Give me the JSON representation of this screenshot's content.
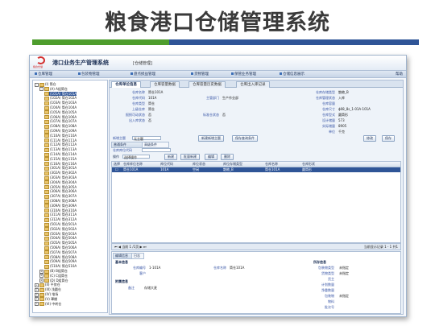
{
  "slide": {
    "title": "粮食港口仓储管理系统"
  },
  "app": {
    "logo_text": "粮食仓储",
    "title": "港口业务生产管理系统",
    "subtitle": "[仓储管理]",
    "menu": [
      "仓库管理",
      "包装物管理",
      "盘点损益管理",
      "货物管理",
      "保管业务管理",
      "仓储信息展示"
    ],
    "help": "帮助"
  },
  "tree": {
    "nodes": [
      {
        "label": "(I) 筒仓",
        "level": 0,
        "pm": "-"
      },
      {
        "label": "(A) A组筒仓",
        "level": 1,
        "pm": "-"
      },
      {
        "label": "(101A) 筒仓101A",
        "level": 2,
        "pm": "",
        "selected": true
      },
      {
        "label": "(102A) 筒仓102A",
        "level": 2,
        "pm": ""
      },
      {
        "label": "(103A) 筒仓103A",
        "level": 2,
        "pm": ""
      },
      {
        "label": "(104A) 筒仓104A",
        "level": 2,
        "pm": ""
      },
      {
        "label": "(105A) 筒仓105A",
        "level": 2,
        "pm": ""
      },
      {
        "label": "(106A) 筒仓106A",
        "level": 2,
        "pm": ""
      },
      {
        "label": "(107A) 筒仓107A",
        "level": 2,
        "pm": ""
      },
      {
        "label": "(108A) 筒仓108A",
        "level": 2,
        "pm": ""
      },
      {
        "label": "(109A) 筒仓109A",
        "level": 2,
        "pm": ""
      },
      {
        "label": "(110A) 筒仓110A",
        "level": 2,
        "pm": ""
      },
      {
        "label": "(111A) 筒仓111A",
        "level": 2,
        "pm": ""
      },
      {
        "label": "(112A) 筒仓112A",
        "level": 2,
        "pm": ""
      },
      {
        "label": "(113A) 筒仓113A",
        "level": 2,
        "pm": ""
      },
      {
        "label": "(114A) 筒仓114A",
        "level": 2,
        "pm": ""
      },
      {
        "label": "(115A) 筒仓115A",
        "level": 2,
        "pm": ""
      },
      {
        "label": "(116A) 筒仓116A",
        "level": 2,
        "pm": ""
      },
      {
        "label": "(301A) 筒仓301A",
        "level": 2,
        "pm": ""
      },
      {
        "label": "(302A) 筒仓302A",
        "level": 2,
        "pm": ""
      },
      {
        "label": "(303A) 筒仓303A",
        "level": 2,
        "pm": ""
      },
      {
        "label": "(304A) 筒仓304A",
        "level": 2,
        "pm": ""
      },
      {
        "label": "(305A) 筒仓305A",
        "level": 2,
        "pm": ""
      },
      {
        "label": "(306A) 筒仓306A",
        "level": 2,
        "pm": ""
      },
      {
        "label": "(307A) 筒仓307A",
        "level": 2,
        "pm": ""
      },
      {
        "label": "(308A) 筒仓308A",
        "level": 2,
        "pm": ""
      },
      {
        "label": "(309A) 筒仓309A",
        "level": 2,
        "pm": ""
      },
      {
        "label": "(310A) 筒仓310A",
        "level": 2,
        "pm": ""
      },
      {
        "label": "(311A) 筒仓311A",
        "level": 2,
        "pm": ""
      },
      {
        "label": "(312A) 筒仓312A",
        "level": 2,
        "pm": ""
      },
      {
        "label": "(501A) 筒仓501A",
        "level": 2,
        "pm": ""
      },
      {
        "label": "(502A) 筒仓502A",
        "level": 2,
        "pm": ""
      },
      {
        "label": "(503A) 筒仓503A",
        "level": 2,
        "pm": ""
      },
      {
        "label": "(504A) 筒仓504A",
        "level": 2,
        "pm": ""
      },
      {
        "label": "(505A) 筒仓505A",
        "level": 2,
        "pm": ""
      },
      {
        "label": "(506A) 筒仓506A",
        "level": 2,
        "pm": ""
      },
      {
        "label": "(507A) 筒仓507A",
        "level": 2,
        "pm": ""
      },
      {
        "label": "(508A) 筒仓508A",
        "level": 2,
        "pm": ""
      },
      {
        "label": "(509A) 筒仓509A",
        "level": 2,
        "pm": ""
      },
      {
        "label": "(510A) 筒仓510A",
        "level": 2,
        "pm": ""
      },
      {
        "label": "(B) B组筒仓",
        "level": 1,
        "pm": "+"
      },
      {
        "label": "(C) C组筒仓",
        "level": 1,
        "pm": "+"
      },
      {
        "label": "(D) D组筒仓",
        "level": 1,
        "pm": "+"
      },
      {
        "label": "(II) 平房仓",
        "level": 0,
        "pm": "+"
      },
      {
        "label": "(III) 浅圆仓",
        "level": 0,
        "pm": "+"
      },
      {
        "label": "(IV) 堆场",
        "level": 0,
        "pm": "+"
      },
      {
        "label": "(V) 罩棚",
        "level": 0,
        "pm": "+"
      },
      {
        "label": "(VI) 中转仓",
        "level": 0,
        "pm": "+"
      }
    ]
  },
  "tabs": [
    "仓库单位信息",
    "仓库容量数据",
    "仓库容量历史数据",
    "仓库出入库记录"
  ],
  "info": {
    "fields_left": [
      {
        "label": "仓库名称",
        "value": "筒仓101A"
      },
      {
        "label": "仓库代码",
        "value": "101A"
      },
      {
        "label": "仓库类型",
        "value": "筒仓"
      },
      {
        "label": "上级仓库",
        "value": "筒仓"
      },
      {
        "label": "报损可动状态",
        "value": "否"
      },
      {
        "label": "出入库状态",
        "value": "否"
      }
    ],
    "fields_mid": [
      {
        "label": "",
        "value": ""
      },
      {
        "label": "主管部门",
        "value": "生产作业部"
      },
      {
        "label": "",
        "value": ""
      },
      {
        "label": "",
        "value": ""
      },
      {
        "label": "标准仓状态",
        "value": "否"
      },
      {
        "label": "",
        "value": ""
      }
    ],
    "fields_right": [
      {
        "label": "仓库存储类型",
        "value": "散粮_B"
      },
      {
        "label": "仓库管理状态",
        "value": "入库"
      },
      {
        "label": "仓库容量",
        "value": ""
      },
      {
        "label": "仓库尺寸",
        "value": "ϕ08_8s_1-01A-101A"
      },
      {
        "label": "仓库型式",
        "value": "圆筒形"
      },
      {
        "label": "设计储量",
        "value": "573"
      },
      {
        "label": "实际储量",
        "value": "8905"
      },
      {
        "label": "单位",
        "value": "千克"
      }
    ],
    "actions": [
      "修改",
      "保存"
    ]
  },
  "toolbar": {
    "label": "新增主题",
    "select_value": "无主题",
    "buttons": [
      "新建新增主题",
      "保存查询条件"
    ]
  },
  "cond_tabs": [
    "普通条件",
    "高级条件"
  ],
  "cond_field_label": "仓库库位代码",
  "ops": {
    "label": "操作",
    "select": "选择操作",
    "buttons": [
      "新建",
      "批量新建",
      "编辑",
      "删除"
    ]
  },
  "grid": {
    "headers": [
      "选择",
      "仓库库位名称",
      "库位代码",
      "库位状态",
      "库位存储类型",
      "仓库名称",
      "仓库形状"
    ],
    "rows": [
      [
        "",
        "筒仓101A",
        "101A",
        "空闲",
        "散粮_B",
        "筒仓101A",
        "圆筒形"
      ]
    ]
  },
  "pager": {
    "page_label": "当前",
    "page": "1",
    "total": "/1页",
    "summary": "当前显示记录 1 - 1 共1"
  },
  "detail": {
    "tabs": [
      "编辑信息",
      "日志"
    ],
    "basic_title": "基本信息",
    "fields": [
      {
        "label": "仓库编号",
        "value": "1-101A"
      },
      {
        "label": "客户",
        "value": ""
      },
      {
        "label": "仓库名称",
        "value": "筒仓101A"
      }
    ],
    "attach_title": "附属信息",
    "note_label": "备注",
    "note_value": "存储大麦",
    "right_title": "所存信息",
    "right_fields": [
      {
        "label": "包装物类型",
        "value": "未指定"
      },
      {
        "label": "货物类型",
        "value": "未指定"
      },
      {
        "label": "货主",
        "value": ""
      },
      {
        "label": "计划数量",
        "value": ""
      },
      {
        "label": "净重数量",
        "value": ""
      },
      {
        "label": "包装物",
        "value": "未指定"
      },
      {
        "label": "物料",
        "value": ""
      },
      {
        "label": "批次号",
        "value": ""
      }
    ]
  },
  "colors": {
    "accent_green": "#4e9d2d",
    "accent_blue": "#2f5597",
    "selection": "#2f5597"
  }
}
